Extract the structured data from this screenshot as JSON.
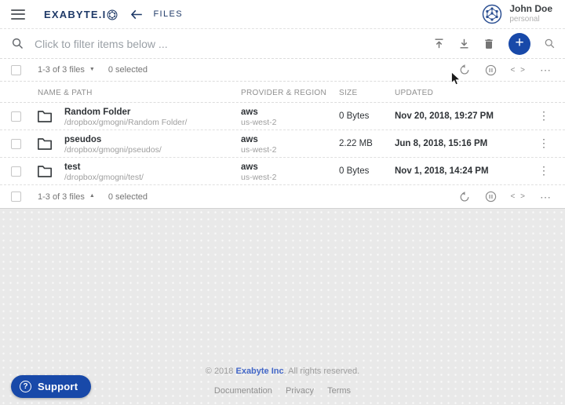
{
  "header": {
    "logo_text": "EXABYTE.I",
    "page_title": "FILES",
    "user": {
      "name": "John Doe",
      "account_type": "personal"
    }
  },
  "filter_bar": {
    "placeholder": "Click to filter items below ..."
  },
  "pagination": {
    "range_label": "1-3 of 3 files",
    "selected_label": "0 selected"
  },
  "table": {
    "columns": [
      "NAME & PATH",
      "PROVIDER & REGION",
      "SIZE",
      "UPDATED"
    ],
    "rows": [
      {
        "name": "Random Folder",
        "path": "/dropbox/gmogni/Random Folder/",
        "provider": "aws",
        "region": "us-west-2",
        "size": "0 Bytes",
        "updated": "Nov 20, 2018, 19:27 PM"
      },
      {
        "name": "pseudos",
        "path": "/dropbox/gmogni/pseudos/",
        "provider": "aws",
        "region": "us-west-2",
        "size": "2.22 MB",
        "updated": "Jun 8, 2018, 15:16 PM"
      },
      {
        "name": "test",
        "path": "/dropbox/gmogni/test/",
        "provider": "aws",
        "region": "us-west-2",
        "size": "0 Bytes",
        "updated": "Nov 1, 2018, 14:24 PM"
      }
    ]
  },
  "footer": {
    "copyright_prefix": "© 2018 ",
    "company_link": "Exabyte Inc",
    "copyright_suffix": ". All rights reserved.",
    "links": [
      "Documentation",
      "Privacy",
      "Terms"
    ]
  },
  "support": {
    "label": "Support",
    "help_glyph": "?"
  },
  "icons": {
    "plus": "+",
    "caret_down": "▼",
    "caret_up": "▲",
    "code_brackets": "< >",
    "more_horizontal": "⋯",
    "more_vertical": "⋮"
  },
  "colors": {
    "navy": "#1f3a68",
    "accent_blue": "#1849a9",
    "link_blue": "#4468c8"
  }
}
